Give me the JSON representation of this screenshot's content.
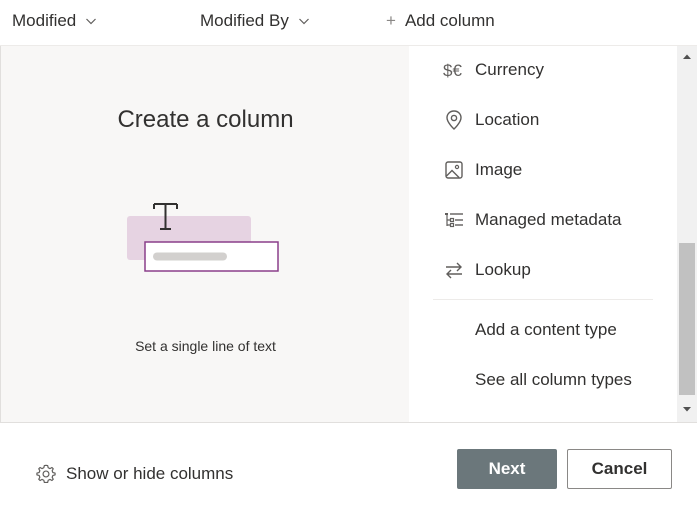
{
  "header": {
    "columns": [
      {
        "label": "Modified",
        "icon": "chevron-down-icon"
      },
      {
        "label": "Modified By",
        "icon": "chevron-down-icon"
      }
    ],
    "add_column": {
      "label": "Add column",
      "icon": "plus-icon"
    }
  },
  "preview": {
    "title": "Create a column",
    "caption": "Set a single line of text"
  },
  "column_types": [
    {
      "label": "Currency",
      "icon": "currency-icon"
    },
    {
      "label": "Location",
      "icon": "location-icon"
    },
    {
      "label": "Image",
      "icon": "image-icon"
    },
    {
      "label": "Managed metadata",
      "icon": "managed-metadata-icon"
    },
    {
      "label": "Lookup",
      "icon": "lookup-icon"
    }
  ],
  "more_options": [
    {
      "label": "Add a content type"
    },
    {
      "label": "See all column types"
    }
  ],
  "footer": {
    "show_hide_label": "Show or hide columns",
    "next_label": "Next",
    "cancel_label": "Cancel"
  },
  "colors": {
    "accent_purple": "#8a3f8a",
    "preview_bg": "#f8f7f6",
    "next_button": "#6b777b"
  }
}
